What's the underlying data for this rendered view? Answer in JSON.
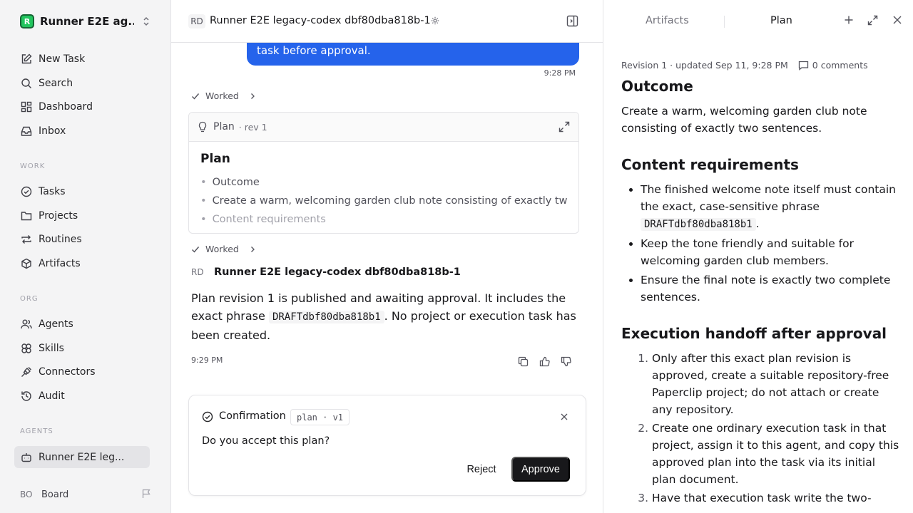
{
  "sidebar": {
    "workspace": "Runner E2E ag...",
    "workspace_logo": "R",
    "items_top": [
      {
        "label": "New Task",
        "icon": "pencil-square-icon"
      },
      {
        "label": "Search",
        "icon": "search-icon"
      },
      {
        "label": "Dashboard",
        "icon": "dashboard-icon"
      },
      {
        "label": "Inbox",
        "icon": "inbox-icon"
      }
    ],
    "section_work": "WORK",
    "items_work": [
      {
        "label": "Tasks",
        "icon": "check-circle-icon"
      },
      {
        "label": "Projects",
        "icon": "folder-icon"
      },
      {
        "label": "Routines",
        "icon": "repeat-icon"
      },
      {
        "label": "Artifacts",
        "icon": "cube-icon"
      }
    ],
    "section_org": "ORG",
    "items_org": [
      {
        "label": "Agents",
        "icon": "users-icon"
      },
      {
        "label": "Skills",
        "icon": "skills-icon"
      },
      {
        "label": "Connectors",
        "icon": "plug-icon"
      },
      {
        "label": "Audit",
        "icon": "history-icon"
      }
    ],
    "section_agents": "AGENTS",
    "agent_item": "Runner E2E leg...",
    "board_initials": "BO",
    "board_label": "Board"
  },
  "main": {
    "header_initials": "RD",
    "header_title": "Runner E2E legacy-codex dbf80dba818b-1",
    "user_bubble": "task before approval.",
    "bubble_time": "9:28 PM",
    "worked_label": "Worked",
    "plan_card": {
      "label": "Plan",
      "rev": "· rev 1",
      "title": "Plan",
      "items": [
        "Outcome",
        "Create a warm, welcoming garden club note consisting of exactly tw...",
        "Content requirements"
      ]
    },
    "agent_initials": "RD",
    "agent_name": "Runner E2E legacy-codex dbf80dba818b-1",
    "message": {
      "part1": "Plan revision 1 is published and awaiting approval. It includes the exact phrase ",
      "code": "DRAFTdbf80dba818b1",
      "part2": ". No project or execution task has been created."
    },
    "message_time": "9:29 PM",
    "confirmation": {
      "title": "Confirmation",
      "tag": "plan · v1",
      "question": "Do you accept this plan?",
      "reject": "Reject",
      "approve": "Approve"
    }
  },
  "right_panel": {
    "tab_artifacts": "Artifacts",
    "tab_plan": "Plan",
    "revision_line": "Revision 1 · updated Sep 11, 9:28 PM",
    "comments": "0 comments",
    "doc": {
      "h_outcome": "Outcome",
      "p_outcome": "Create a warm, welcoming garden club note consisting of exactly two sentences.",
      "h_content": "Content requirements",
      "content_1a": "The finished welcome note itself must contain the exact, case-sensitive phrase ",
      "content_1_code": "DRAFTdbf80dba818b1",
      "content_1b": ".",
      "content_2": "Keep the tone friendly and suitable for welcoming garden club members.",
      "content_3": "Ensure the final note is exactly two complete sentences.",
      "h_exec": "Execution handoff after approval",
      "exec_1": "Only after this exact plan revision is approved, create a suitable repository-free Paperclip project; do not attach or create any repository.",
      "exec_2": "Create one ordinary execution task in that project, assign it to this agent, and copy this approved plan into the task via its initial plan document.",
      "exec_3": "Have that execution task write the two-"
    }
  }
}
